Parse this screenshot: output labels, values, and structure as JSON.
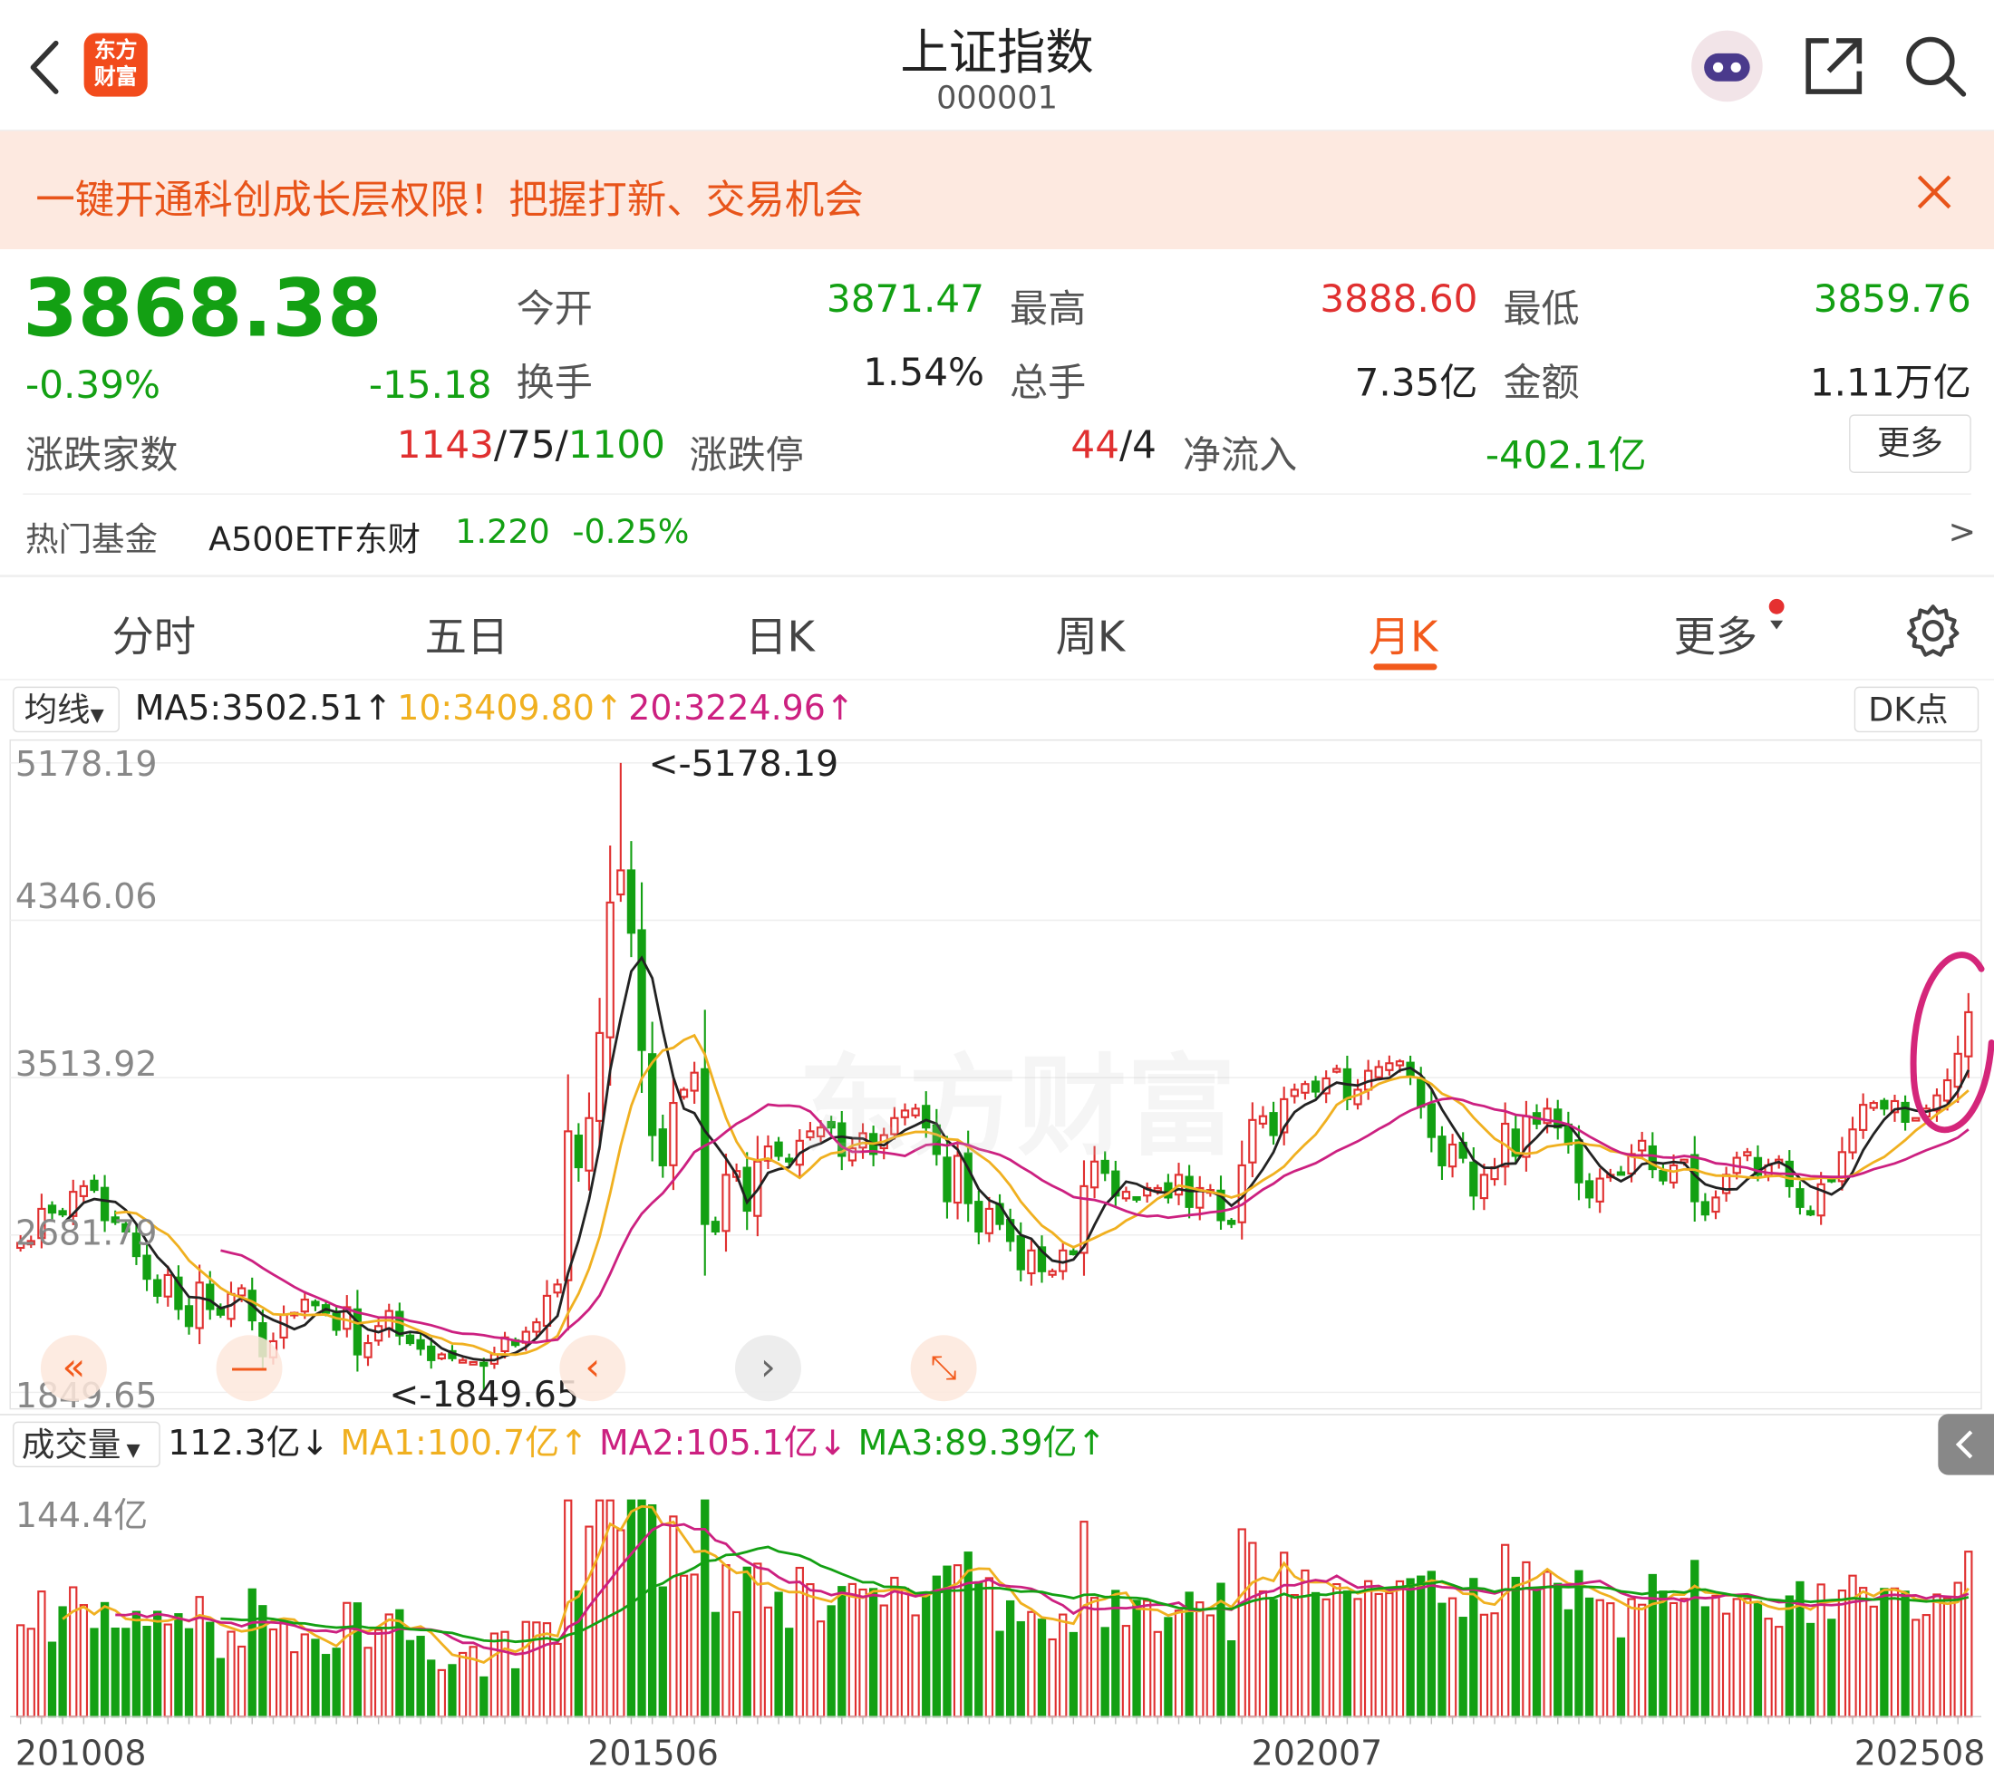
{
  "header": {
    "title": "上证指数",
    "code": "000001",
    "logo_line1": "东方",
    "logo_line2": "财富"
  },
  "banner": {
    "text": "一键开通科创成长层权限！把握打新、交易机会"
  },
  "quote": {
    "price": "3868.38",
    "change_pct": "-0.39%",
    "change": "-15.18",
    "open_label": "今开",
    "open": "3871.47",
    "high_label": "最高",
    "high": "3888.60",
    "low_label": "最低",
    "low": "3859.76",
    "turnover_label": "换手",
    "turnover": "1.54%",
    "volume_label": "总手",
    "volume": "7.35亿",
    "amount_label": "金额",
    "amount": "1.11万亿",
    "breadth_label": "涨跌家数",
    "breadth_up": "1143",
    "breadth_flat": "/75/",
    "breadth_down": "1100",
    "limit_label": "涨跌停",
    "limit_up": "44",
    "limit_down": "/4",
    "netflow_label": "净流入",
    "netflow": "-402.1亿",
    "more_label": "更多"
  },
  "fund": {
    "label": "热门基金",
    "name": "A500ETF东财",
    "price": "1.220",
    "pct": "-0.25%",
    "arrow": ">"
  },
  "tabs": [
    "分时",
    "五日",
    "日K",
    "周K",
    "月K",
    "更多"
  ],
  "active_tab": "月K",
  "ma_bar": {
    "selector": "均线",
    "ma5": "MA5:3502.51↑",
    "ma10": "10:3409.80↑",
    "ma20": "20:3224.96↑",
    "dk": "DK点"
  },
  "price_axis": [
    "5178.19",
    "4346.06",
    "3513.92",
    "2681.79",
    "1849.65"
  ],
  "annotations": {
    "high": "<-5178.19",
    "low": "<-1849.65"
  },
  "vol_bar": {
    "selector": "成交量",
    "value": "112.3亿↓",
    "ma1": "MA1:100.7亿↑",
    "ma2": "MA2:105.1亿↓",
    "ma3": "MA3:89.39亿↑"
  },
  "vol_axis_top": "144.4亿",
  "x_labels": [
    "201008",
    "201506",
    "202007",
    "202508"
  ],
  "watermark": "东方财富",
  "colors": {
    "up": "#e03030",
    "down": "#13a013",
    "ma5": "#222222",
    "ma10": "#f0b020",
    "ma20": "#cc2080",
    "accent": "#f25a1c"
  },
  "icons": [
    "back-icon",
    "robot-avatar-icon",
    "share-icon",
    "search-icon",
    "close-icon",
    "gear-icon",
    "collapse-icon"
  ],
  "chart_data": {
    "type": "candlestick",
    "period": "monthly",
    "x_start": "201008",
    "x_end": "202508",
    "close": [
      2640,
      2650,
      2820,
      2800,
      2790,
      2910,
      2940,
      2920,
      2760,
      2750,
      2700,
      2570,
      2450,
      2360,
      2470,
      2290,
      2200,
      2430,
      2290,
      2260,
      2370,
      2400,
      2230,
      2040,
      2120,
      2260,
      2270,
      2340,
      2310,
      2270,
      2180,
      2300,
      2050,
      2110,
      2200,
      2280,
      2150,
      2110,
      2080,
      2020,
      2050,
      2030,
      2020,
      2010,
      1990,
      2050,
      2140,
      2100,
      2170,
      2220,
      2360,
      2420,
      3230,
      3040,
      3300,
      3750,
      4440,
      4610,
      4280,
      3660,
      3210,
      3050,
      3380,
      3450,
      3540,
      2740,
      2700,
      3000,
      3020,
      2810,
      3070,
      3150,
      3100,
      3070,
      3180,
      3230,
      3250,
      3250,
      3100,
      3140,
      3220,
      3110,
      3210,
      3300,
      3340,
      3350,
      3250,
      3110,
      2860,
      3100,
      2850,
      2700,
      2820,
      2740,
      2650,
      2500,
      2600,
      2490,
      2490,
      2600,
      2580,
      2940,
      3070,
      3010,
      2890,
      2910,
      2880,
      2930,
      2930,
      2880,
      3000,
      2830,
      2930,
      2920,
      2760,
      2740,
      3050,
      3290,
      3310,
      3210,
      3400,
      3450,
      3480,
      3440,
      3510,
      3560,
      3400,
      3450,
      3550,
      3570,
      3590,
      3600,
      3520,
      3360,
      3200,
      3050,
      3160,
      3090,
      2890,
      3000,
      3040,
      3270,
      3100,
      3310,
      3270,
      3350,
      3250,
      3160,
      2960,
      2880,
      2980,
      3000,
      3010,
      3110,
      3180,
      3030,
      2970,
      3050,
      3080,
      2860,
      2790,
      2880,
      3000,
      3090,
      3120,
      3000,
      3050,
      3080,
      2940,
      2830,
      2790,
      2950,
      2970,
      3120,
      3240,
      3370,
      3380,
      3350,
      3390,
      3280,
      3300,
      3350,
      3420,
      3500,
      3640,
      3860
    ]
  }
}
